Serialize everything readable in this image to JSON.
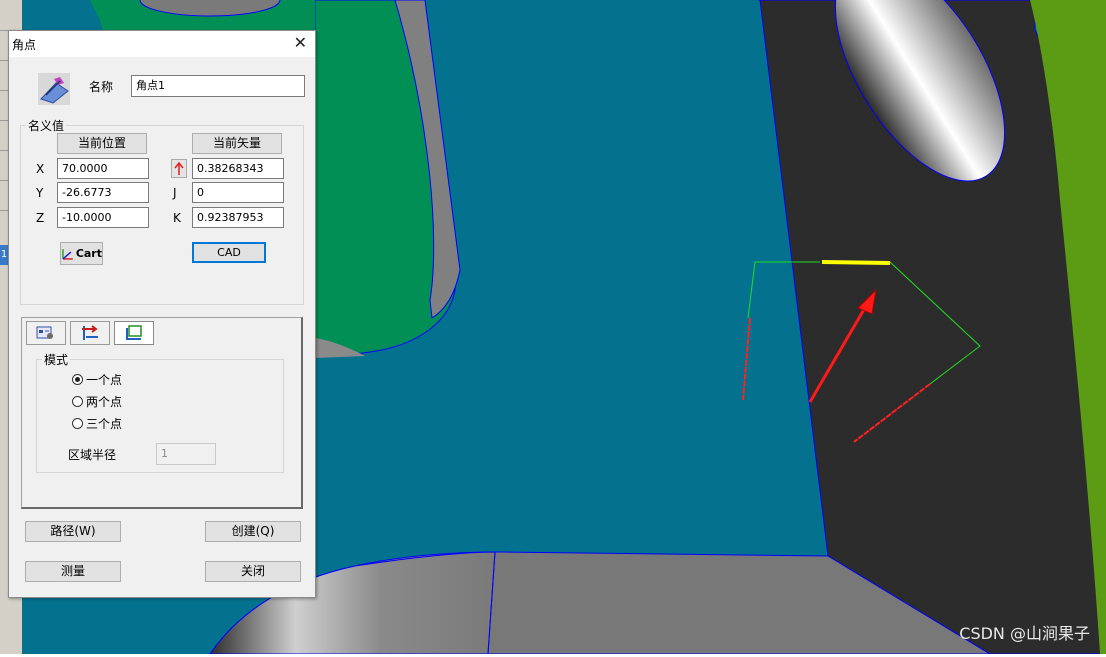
{
  "dialog": {
    "title": "角点",
    "name_label": "名称",
    "name_value": "角点1",
    "nominal_group": "名义值",
    "current_position_button": "当前位置",
    "current_vector_button": "当前矢量",
    "x_label": "X",
    "x_value": "70.0000",
    "y_label": "Y",
    "y_value": "-26.6773",
    "z_label": "Z",
    "z_value": "-10.0000",
    "i_value": "0.38268343",
    "j_label": "J",
    "j_value": "0",
    "k_label": "K",
    "k_value": "0.92387953",
    "cart_button": "Cart",
    "cad_button": "CAD",
    "mode_group": "模式",
    "mode_options": [
      "一个点",
      "两个点",
      "三个点"
    ],
    "mode_selected": 0,
    "radius_label": "区域半径",
    "radius_value": "1",
    "path_button": "路径(W)",
    "create_button": "创建(Q)",
    "measure_button": "测量",
    "close_button": "关闭"
  },
  "strip": {
    "badge": "1"
  },
  "watermark": "CSDN @山涧果子",
  "colors": {
    "blue_face": "#04728f",
    "green_face": "#018f55",
    "dark_face": "#2c2c2c",
    "lime_face": "#5c9c14",
    "grey_face": "#7a7a7a",
    "vector": "#ff1a1a",
    "highlight": "#ffff00",
    "edge": "#0000ff",
    "dialog_bg": "#f0f0f0"
  },
  "icons": [
    "point-feature-icon",
    "close-icon",
    "vector-arrow-icon",
    "cart-axes-icon",
    "tab-settings-icon",
    "tab-swap-icon",
    "tab-point-icon"
  ]
}
